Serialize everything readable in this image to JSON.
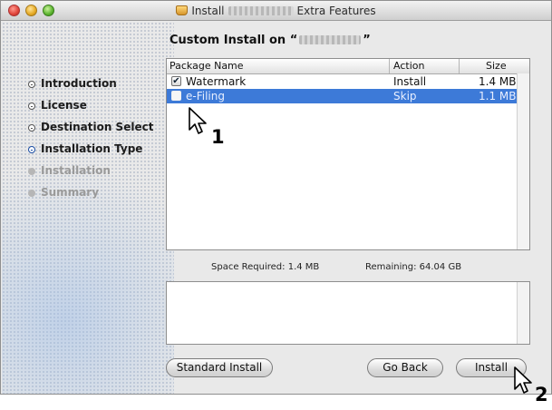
{
  "window": {
    "title_prefix": "Install",
    "title_suffix": "Extra Features"
  },
  "heading": {
    "prefix": "Custom Install on “",
    "suffix": "”"
  },
  "sidebar": {
    "steps": [
      {
        "label": "Introduction",
        "state": "completed"
      },
      {
        "label": "License",
        "state": "completed"
      },
      {
        "label": "Destination Select",
        "state": "completed"
      },
      {
        "label": "Installation Type",
        "state": "current"
      },
      {
        "label": "Installation",
        "state": "pending"
      },
      {
        "label": "Summary",
        "state": "pending"
      }
    ]
  },
  "table": {
    "columns": {
      "name": "Package Name",
      "action": "Action",
      "size": "Size"
    },
    "rows": [
      {
        "name": "Watermark",
        "action": "Install",
        "size": "1.4 MB",
        "checked": true,
        "selected": false
      },
      {
        "name": "e-Filing",
        "action": "Skip",
        "size": "1.1 MB",
        "checked": false,
        "selected": true
      }
    ]
  },
  "footer": {
    "space_required": "Space Required:  1.4 MB",
    "remaining": "Remaining:  64.04 GB"
  },
  "buttons": {
    "standard": "Standard Install",
    "back": "Go Back",
    "install": "Install"
  },
  "callouts": {
    "one": "1",
    "two": "2"
  },
  "colors": {
    "selection": "#3d7ad8",
    "active_step": "#1d4fa5"
  }
}
